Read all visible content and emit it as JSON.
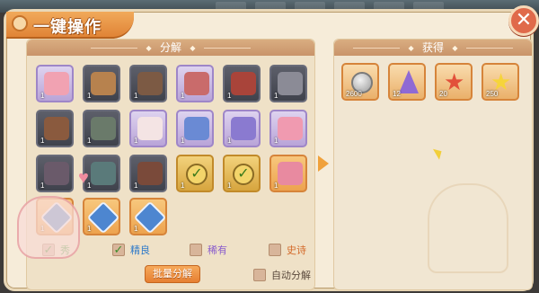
{
  "window": {
    "title": "一键操作",
    "close_glyph": "✕"
  },
  "top_tabs": [
    "",
    "",
    "",
    "",
    "",
    ""
  ],
  "left_panel": {
    "title": "分解",
    "items": [
      {
        "name": "pink-boots-item",
        "qty": "1",
        "rarity": "purple",
        "color": "#f1a2b2"
      },
      {
        "name": "bronze-chain-item",
        "qty": "1",
        "rarity": "dark",
        "color": "#b7824e"
      },
      {
        "name": "dark-armor-item",
        "qty": "1",
        "rarity": "dark",
        "color": "#7c5a44"
      },
      {
        "name": "red-pants-item",
        "qty": "1",
        "rarity": "purple",
        "color": "#c96b6b"
      },
      {
        "name": "red-staff-item",
        "qty": "1",
        "rarity": "dark",
        "color": "#a9443a"
      },
      {
        "name": "pistol-item",
        "qty": "1",
        "rarity": "dark",
        "color": "#8b8b96"
      },
      {
        "name": "brown-cloak-item",
        "qty": "1",
        "rarity": "dark",
        "color": "#8a5a3e"
      },
      {
        "name": "mech-armor-item",
        "qty": "1",
        "rarity": "dark",
        "color": "#6a7a6a"
      },
      {
        "name": "white-skirt-item",
        "qty": "1",
        "rarity": "purple",
        "color": "#f4e4e4"
      },
      {
        "name": "blue-boots-item",
        "qty": "1",
        "rarity": "purple",
        "color": "#6a8ad4"
      },
      {
        "name": "bow-item",
        "qty": "1",
        "rarity": "purple",
        "color": "#8a7ad0"
      },
      {
        "name": "pink-gun-item",
        "qty": "1",
        "rarity": "purple",
        "color": "#f09ab0"
      },
      {
        "name": "dark-helmet-item",
        "qty": "1",
        "rarity": "dark",
        "color": "#6a5a6a"
      },
      {
        "name": "green-chest-item",
        "qty": "1",
        "rarity": "dark",
        "color": "#5a7a7a"
      },
      {
        "name": "spear-item",
        "qty": "1",
        "rarity": "dark",
        "color": "#7a4a3a"
      },
      {
        "name": "gold-check-item",
        "qty": "1",
        "rarity": "gold",
        "color": "#f3d56a"
      },
      {
        "name": "gold-check-item-2",
        "qty": "1",
        "rarity": "gold",
        "color": "#f3d56a"
      },
      {
        "name": "pink-frame-item",
        "qty": "1",
        "rarity": "orange",
        "color": "#e88aa0"
      },
      {
        "name": "blue-gem-item",
        "qty": "1",
        "rarity": "orange",
        "color": "#4d86d0"
      },
      {
        "name": "blue-gem-item-2",
        "qty": "1",
        "rarity": "orange",
        "color": "#4d86d0"
      },
      {
        "name": "blue-gem-item-3",
        "qty": "1",
        "rarity": "orange",
        "color": "#4d86d0"
      }
    ],
    "filters": [
      {
        "label": "秀",
        "checked": true,
        "color": "#3f9a35"
      },
      {
        "label": "精良",
        "checked": true,
        "color": "#2f7ac9"
      },
      {
        "label": "稀有",
        "checked": false,
        "color": "#8a5ccc"
      },
      {
        "label": "史诗",
        "checked": false,
        "color": "#d46a2a"
      }
    ],
    "batch_button": "批量分解",
    "auto_label": "自动分解"
  },
  "right_panel": {
    "title": "获得",
    "rewards": [
      {
        "name": "silver-coin",
        "qty": "2600",
        "icon": "coin-icon"
      },
      {
        "name": "crystal",
        "qty": "12",
        "icon": "crystal-icon"
      },
      {
        "name": "red-star",
        "qty": "20",
        "icon": "red-star-icon"
      },
      {
        "name": "gold-star",
        "qty": "250",
        "icon": "gold-star-icon"
      }
    ]
  }
}
